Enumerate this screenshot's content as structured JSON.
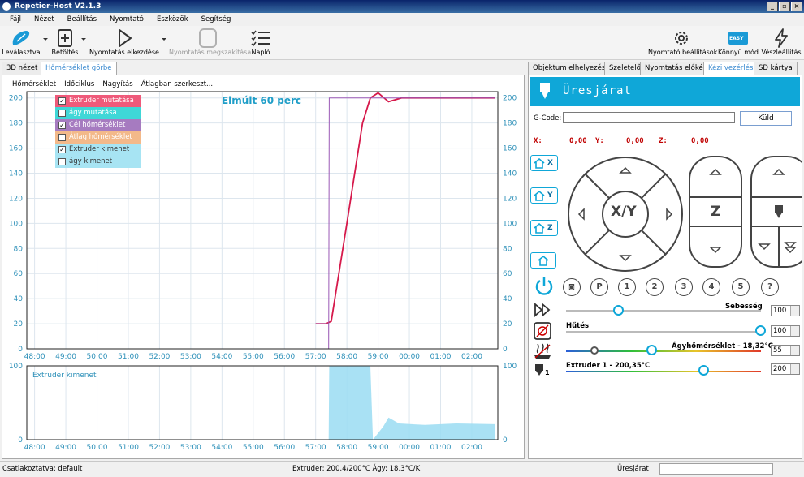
{
  "window": {
    "title": "Repetier-Host V2.1.3",
    "controls": [
      "_",
      "▫",
      "×"
    ]
  },
  "menu": [
    "Fájl",
    "Nézet",
    "Beállítás",
    "Nyomtató",
    "Eszközök",
    "Segítség"
  ],
  "toolbar": {
    "slice": "Leválasztva",
    "load": "Betöltés",
    "start": "Nyomtatás elkezdése",
    "stop": "Nyomtatás megszakítása",
    "log": "Napló",
    "printer_settings": "Nyomtató beállítások",
    "easy_mode": "Könnyű mód",
    "easy_badge": "EASY",
    "emergency": "Vészleállítás"
  },
  "left_tabs": [
    "3D nézet",
    "Hőmérséklet görbe"
  ],
  "right_tabs": [
    "Objektum elhelyezése",
    "Szeletelő",
    "Nyomtatás előkép",
    "Kézi vezérlés",
    "SD kártya"
  ],
  "chart_menu": [
    "Hőmérséklet",
    "Időciklus",
    "Nagyítás",
    "Átlagban szerkeszt..."
  ],
  "legend": [
    {
      "label": "Extruder mutatása",
      "checked": true,
      "color": "#ef5a7a"
    },
    {
      "label": "ágy mutatása",
      "checked": false,
      "color": "#3fd7d7"
    },
    {
      "label": "Cél hőmérséklet",
      "checked": true,
      "color": "#a67bc0"
    },
    {
      "label": "Átlag hőmérséklet",
      "checked": false,
      "color": "#f3b98a"
    },
    {
      "label": "Extruder kimenet",
      "checked": true,
      "color": "#a7e4f3"
    },
    {
      "label": "ágy kimenet",
      "checked": false,
      "color": "#a7e4f3"
    }
  ],
  "chart_data": [
    {
      "type": "line",
      "title": "Elmúlt 60 perc",
      "x_ticks": [
        "48:00",
        "49:00",
        "50:00",
        "51:00",
        "52:00",
        "53:00",
        "54:00",
        "55:00",
        "56:00",
        "57:00",
        "58:00",
        "59:00",
        "00:00",
        "01:00",
        "02:00"
      ],
      "y_ticks": [
        0,
        20,
        40,
        60,
        80,
        100,
        120,
        140,
        160,
        180,
        200
      ],
      "ylim": [
        0,
        205
      ],
      "series": [
        {
          "name": "Extruder mutatása",
          "color": "#d6194b",
          "x": [
            "57:00",
            "57:20",
            "57:30",
            "58:00",
            "58:30",
            "58:45",
            "59:00",
            "59:20",
            "59:45",
            "00:30",
            "02:45"
          ],
          "y": [
            20,
            20,
            22,
            100,
            180,
            200,
            204,
            197,
            200,
            200,
            200
          ]
        },
        {
          "name": "Cél hőmérséklet",
          "color": "#9b59b6",
          "x": [
            "57:00",
            "57:25",
            "57:25",
            "57:26",
            "02:45"
          ],
          "y": [
            20,
            20,
            0,
            200,
            200
          ]
        }
      ]
    },
    {
      "type": "area",
      "title": "Extruder kimenet",
      "x_ticks": [
        "48:00",
        "49:00",
        "50:00",
        "51:00",
        "52:00",
        "53:00",
        "54:00",
        "55:00",
        "56:00",
        "57:00",
        "58:00",
        "59:00",
        "00:00",
        "01:00",
        "02:00"
      ],
      "y_ticks": [
        0,
        100
      ],
      "ylim": [
        0,
        100
      ],
      "series": [
        {
          "name": "Extruder kimenet",
          "color": "#9adcf2",
          "x": [
            "57:25",
            "57:26",
            "58:45",
            "58:50",
            "59:10",
            "59:20",
            "59:40",
            "00:30",
            "01:30",
            "02:45"
          ],
          "y": [
            0,
            100,
            100,
            0,
            18,
            30,
            22,
            20,
            22,
            21
          ]
        }
      ]
    }
  ],
  "manual": {
    "status": "Üresjárat",
    "gcode_label": "G-Code:",
    "send": "Küld",
    "x_label": "X:",
    "x_val": "0,00",
    "y_label": "Y:",
    "y_val": "0,00",
    "z_label": "Z:",
    "z_val": "0,00",
    "home_x": "X",
    "home_y": "Y",
    "home_z": "Z",
    "xy": "X/Y",
    "z": "Z",
    "circles": [
      "P",
      "1",
      "2",
      "3",
      "4",
      "5",
      "?"
    ],
    "speed_label": "Sebesség",
    "speed_val": "100",
    "fan_label": "Hűtés",
    "fan_val": "100",
    "bed_label": "Ágyhőmérséklet - 18,32°C",
    "bed_val": "55",
    "ext_label": "Extruder 1 - 200,35°C",
    "ext_val": "200",
    "ext_num": "1",
    "speed_level": 0.27,
    "fan_level": 1.0,
    "bed_level": 0.44,
    "ext_level": 0.71
  },
  "status": {
    "connection": "Csatlakoztatva: default",
    "temps": "Extruder: 200,4/200°C Ágy: 18,3°C/Ki",
    "state": "Üresjárat"
  }
}
